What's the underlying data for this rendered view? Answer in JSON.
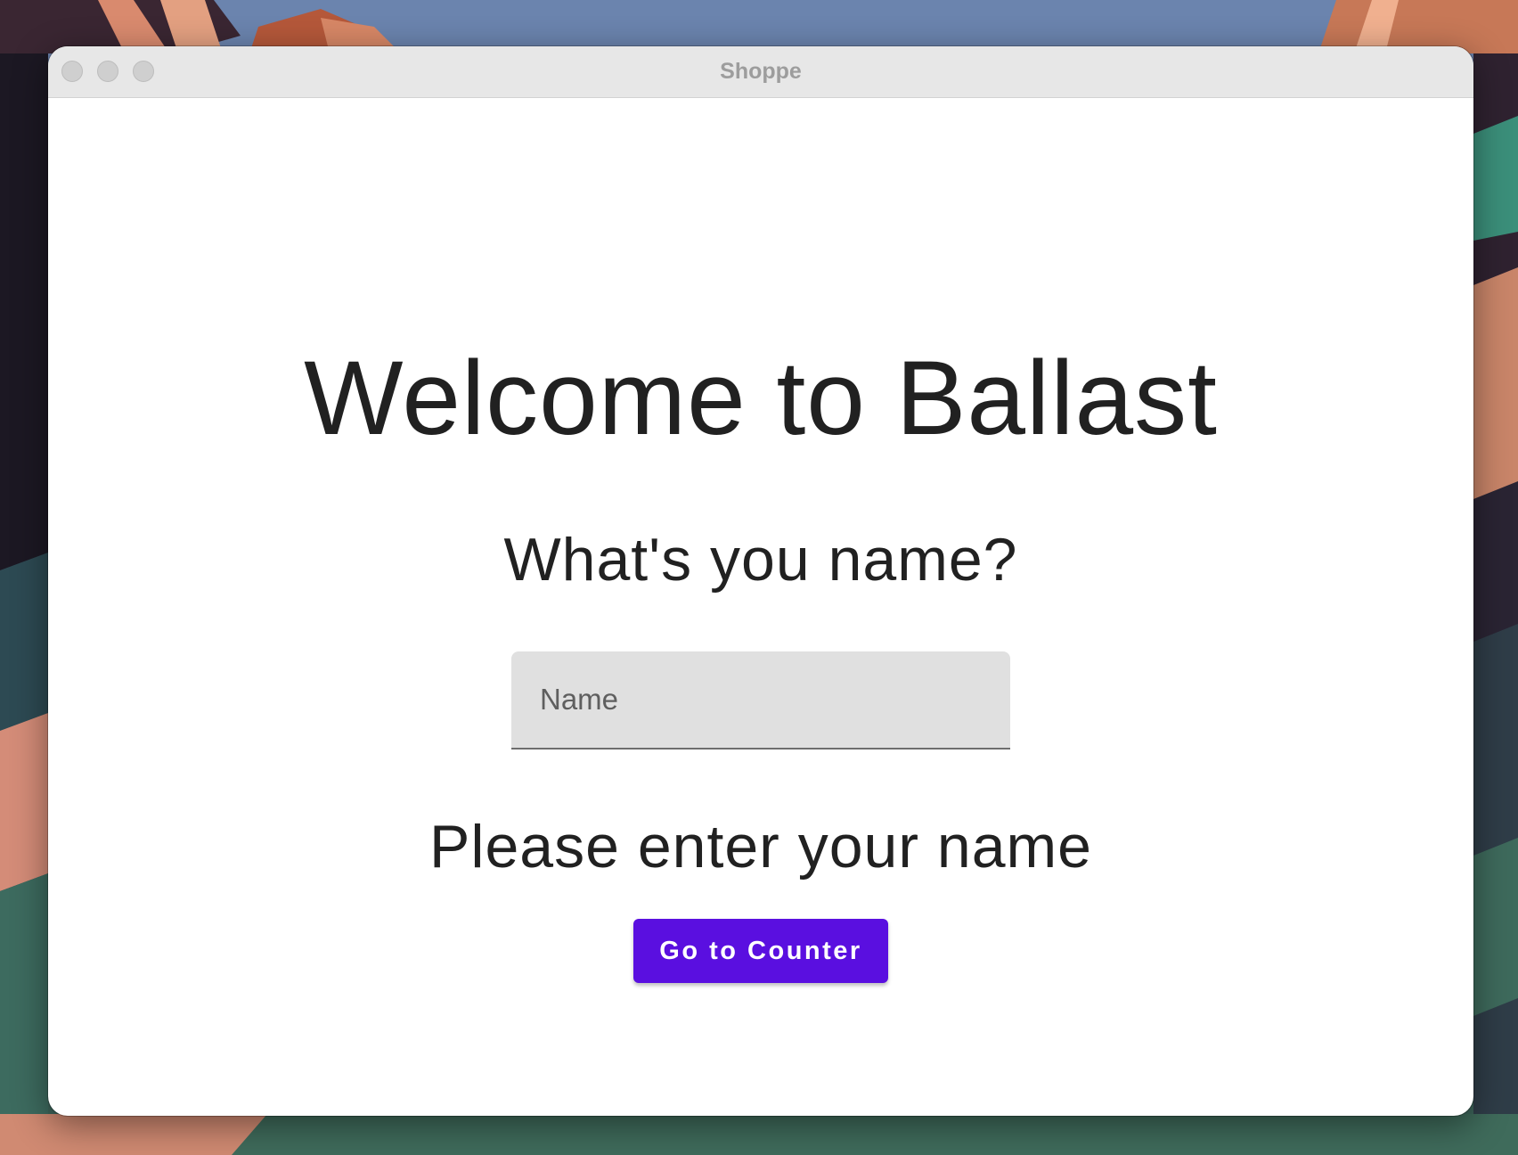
{
  "window": {
    "title": "Shoppe"
  },
  "main": {
    "heading": "Welcome to Ballast",
    "question": "What's you name?",
    "name_input": {
      "placeholder": "Name",
      "value": ""
    },
    "prompt": "Please enter your name",
    "button_label": "Go to Counter"
  },
  "colors": {
    "accent": "#5a0fe0",
    "text": "#212121",
    "field_background": "#e0e0e0",
    "titlebar": "#e7e7e7"
  }
}
